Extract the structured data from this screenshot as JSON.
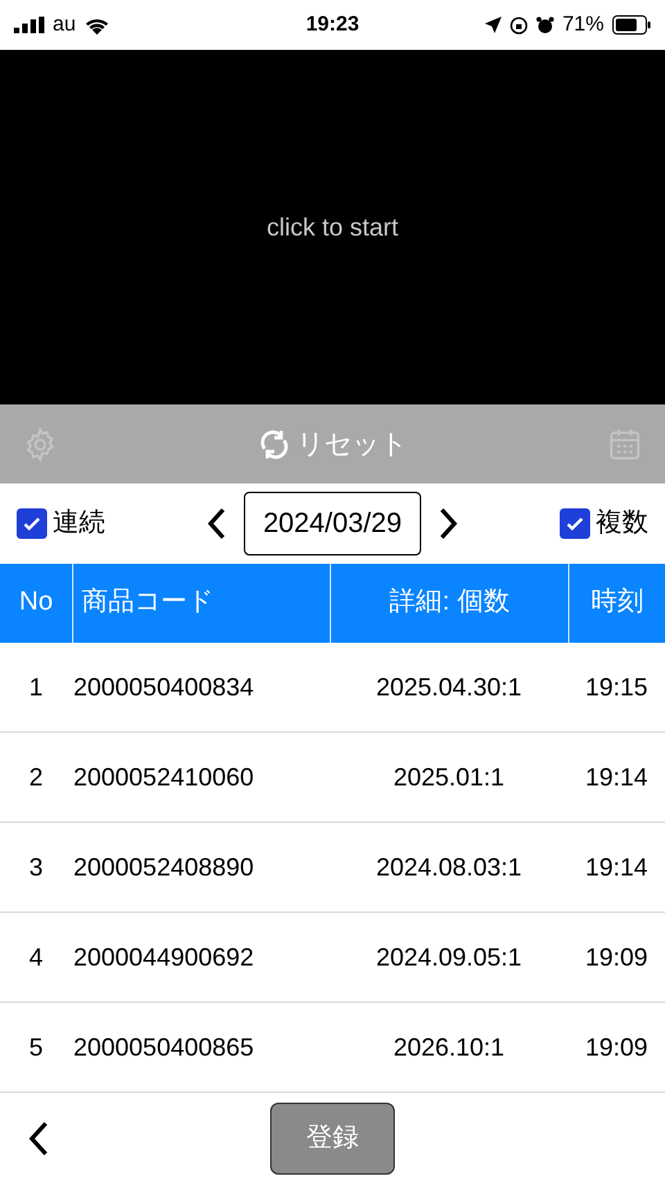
{
  "status_bar": {
    "carrier": "au",
    "time": "19:23",
    "battery": "71%"
  },
  "camera": {
    "prompt": "click to start"
  },
  "toolbar": {
    "reset_label": "リセット"
  },
  "controls": {
    "continuous": {
      "label": "連続",
      "checked": true
    },
    "date": "2024/03/29",
    "multiple": {
      "label": "複数",
      "checked": true
    }
  },
  "table": {
    "columns": [
      "No",
      "商品コード",
      "詳細: 個数",
      "時刻"
    ],
    "rows": [
      {
        "no": "1",
        "code": "2000050400834",
        "detail": "2025.04.30:1",
        "time": "19:15"
      },
      {
        "no": "2",
        "code": "2000052410060",
        "detail": "2025.01:1",
        "time": "19:14"
      },
      {
        "no": "3",
        "code": "2000052408890",
        "detail": "2024.08.03:1",
        "time": "19:14"
      },
      {
        "no": "4",
        "code": "2000044900692",
        "detail": "2024.09.05:1",
        "time": "19:09"
      },
      {
        "no": "5",
        "code": "2000050400865",
        "detail": "2026.10:1",
        "time": "19:09"
      }
    ]
  },
  "footer": {
    "register_button": "登録"
  }
}
